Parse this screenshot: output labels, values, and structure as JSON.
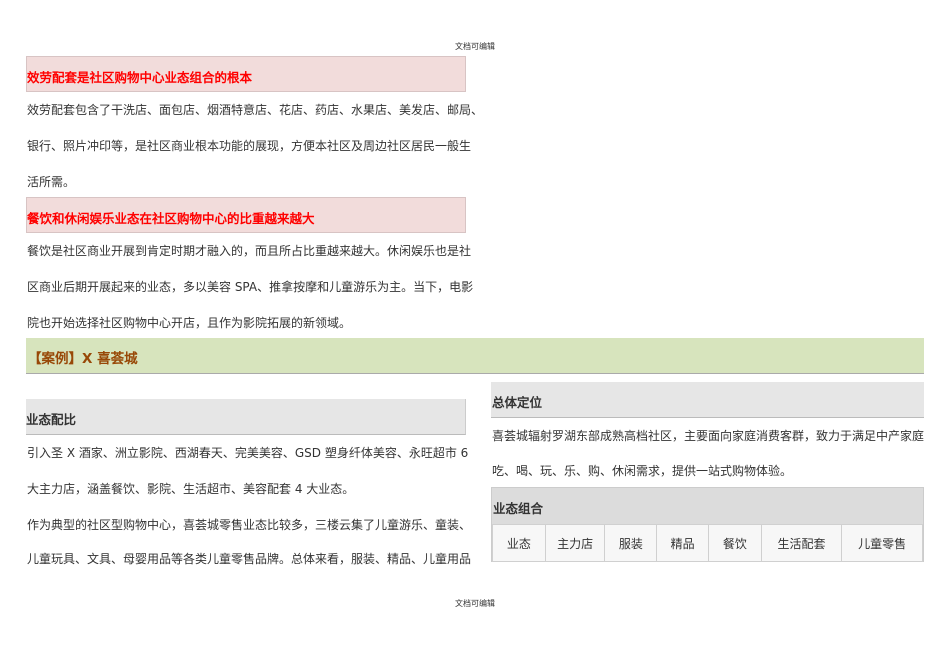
{
  "header": "文档可编辑",
  "footer": "文档可编辑",
  "section1": {
    "title": "效劳配套是社区购物中心业态组合的根本",
    "lines": [
      "效劳配套包含了干洗店、面包店、烟酒特意店、花店、药店、水果店、美发店、邮局、",
      "银行、照片冲印等，是社区商业根本功能的展现，方便本社区及周边社区居民一般生",
      "活所需。"
    ]
  },
  "section2": {
    "title": "餐饮和休闲娱乐业态在社区购物中心的比重越来越大",
    "lines": [
      "餐饮是社区商业开展到肯定时期才融入的，而且所占比重越来越大。休闲娱乐也是社",
      "区商业后期开展起来的业态，多以美容 SPA、推拿按摩和儿童游乐为主。当下，电影",
      "院也开始选择社区购物中心开店，且作为影院拓展的新领域。"
    ]
  },
  "case_title": "【案例】X 喜荟城",
  "ratio": {
    "title": "业态配比",
    "lines": [
      "引入圣 X 酒家、洲立影院、西湖春天、完美美容、GSD 塑身纤体美容、永旺超市 6",
      "大主力店，涵盖餐饮、影院、生活超市、美容配套 4 大业态。",
      "作为典型的社区型购物中心，喜荟城零售业态比较多，三楼云集了儿童游乐、童装、",
      "儿童玩具、文具、母婴用品等各类儿童零售品牌。总体来看，服装、精品、儿童用品"
    ]
  },
  "positioning": {
    "title": "总体定位",
    "lines": [
      "喜荟城辐射罗湖东部成熟高档社区，主要面向家庭消费客群，致力于满足中产家庭",
      "吃、喝、玩、乐、购、休闲需求，提供一站式购物体验。"
    ]
  },
  "mix": {
    "title": "业态组合",
    "columns": [
      "业态",
      "主力店",
      "服装",
      "精品",
      "餐饮",
      "生活配套",
      "儿童零售"
    ]
  }
}
